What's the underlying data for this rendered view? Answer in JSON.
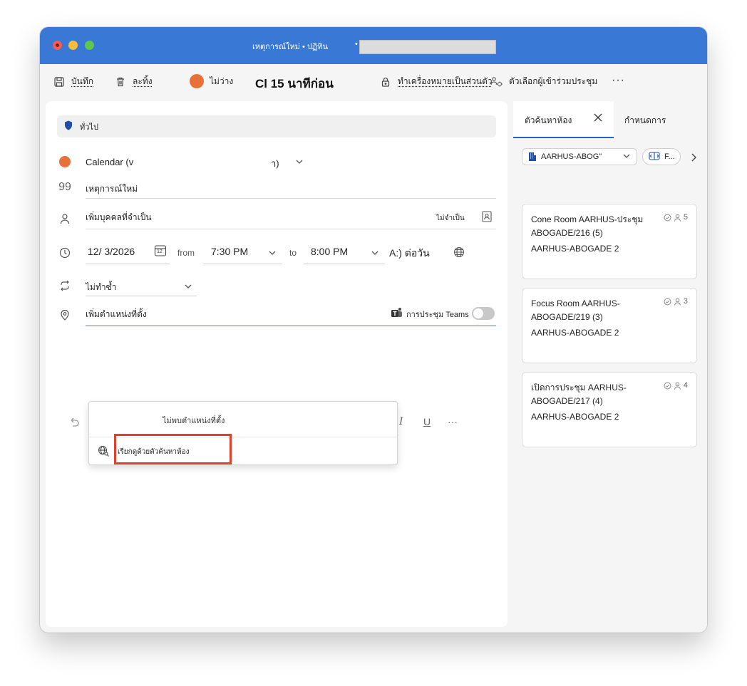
{
  "window": {
    "title": "เหตุการณ์ใหม่ • ปฏิทิน",
    "title_dot": "•"
  },
  "toolbar": {
    "save_label": "บันทึก",
    "discard_label": "ละทิ้ง",
    "status_label": "ไม่ว่าง",
    "reminder_label": "Cl 15 นาทีก่อน",
    "private_label": "ทำเครื่องหมายเป็นส่วนตัว",
    "attendee_options_label": "ตัวเลือกผู้เข้าร่วมประชุม",
    "more_label": "···"
  },
  "form": {
    "banner_label": "ทั่วไป",
    "calendar_label": "Calendar (v",
    "calendar_suffix": "า)",
    "title_value": "เหตุการณ์ใหม่",
    "attendees_placeholder": "เพิ่มบุคคลที่จำเป็น",
    "optional_label": "ไม่จำเป็น",
    "date_value": "12/ 3/2026",
    "date_icon_number": "12",
    "from_label": "from",
    "start_time": "7:30 PM",
    "to_label": "to",
    "end_time": "8:00 PM",
    "all_day_label": "A:) ต่อวัน",
    "repeat_value": "ไม่ทำซ้ำ",
    "location_placeholder": "เพิ่มตำแหน่งที่ตั้ง",
    "teams_label": "การประชุม Teams",
    "format_more": "···"
  },
  "location_dropdown": {
    "no_results": "ไม่พบตำแหน่งที่ตั้ง",
    "browse_label": "เรียกดูด้วยตัวค้นหาห้อง"
  },
  "side_panel": {
    "tab_room_finder": "ตัวค้นหาห้อง",
    "tab_scheduling": "กำหนดการ",
    "building_filter": "AARHUS-ABOG\"",
    "features_filter": "F...",
    "rooms": [
      {
        "name": "Cone Room AARHUS-ประชุม ABOGADE/216 (5)",
        "building": "AARHUS-ABOGADE 2",
        "capacity": "5"
      },
      {
        "name": "Focus Room AARHUS-ABOGADE/219 (3)",
        "building": "AARHUS-ABOGADE 2",
        "capacity": "3"
      },
      {
        "name": "เปิดการประชุม AARHUS-ABOGADE/217 (4)",
        "building": "AARHUS-ABOGADE 2",
        "capacity": "4"
      }
    ]
  },
  "colors": {
    "titlebar": "#3a78d6",
    "status_busy": "#e8713a",
    "highlight": "#e0412d",
    "accent": "#1a66c9"
  }
}
